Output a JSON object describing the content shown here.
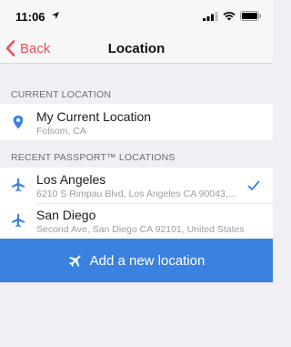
{
  "status_bar": {
    "time": "11:06"
  },
  "nav": {
    "back_label": "Back",
    "title": "Location"
  },
  "current_section": {
    "header": "CURRENT LOCATION",
    "item": {
      "title": "My Current Location",
      "subtitle": "Folsom, CA",
      "icon": "location-pin-icon"
    }
  },
  "recent_section": {
    "header": "RECENT PASSPORT™ LOCATIONS",
    "items": [
      {
        "title": "Los Angeles",
        "subtitle": "6210 S Rimpau Blvd, Los Angeles CA 90043,...",
        "icon": "airplane-icon",
        "selected": true
      },
      {
        "title": "San Diego",
        "subtitle": "Second Ave, San Diego CA 92101, United States",
        "icon": "airplane-icon",
        "selected": false
      }
    ]
  },
  "add_button": {
    "label": "Add a new location",
    "icon": "airplane-icon"
  },
  "colors": {
    "accent": "#3b82e0",
    "back": "#e8505b",
    "background": "#efeff4"
  }
}
